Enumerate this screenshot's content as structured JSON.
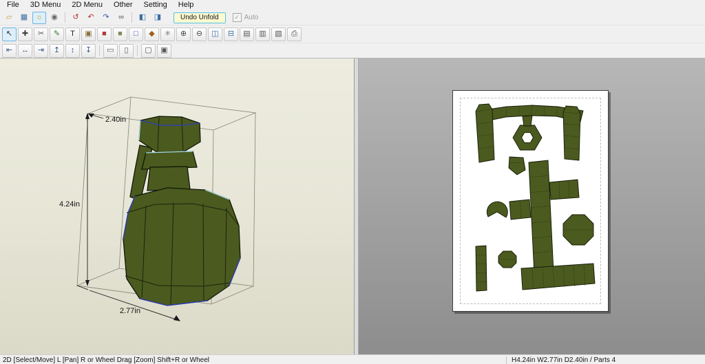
{
  "menubar": {
    "items": [
      {
        "label": "File"
      },
      {
        "label": "3D Menu"
      },
      {
        "label": "2D Menu"
      },
      {
        "label": "Other"
      },
      {
        "label": "Setting"
      },
      {
        "label": "Help"
      }
    ]
  },
  "toolbar_main": {
    "icons": [
      {
        "name": "open-file-icon",
        "glyph": "▱",
        "color": "#c89638"
      },
      {
        "name": "save-file-icon",
        "glyph": "▦",
        "color": "#3a6ea5"
      },
      {
        "name": "light-toggle-icon",
        "glyph": "☼",
        "color": "#d89c00",
        "active": true
      },
      {
        "name": "snapshot-icon",
        "glyph": "◉",
        "color": "#666666"
      },
      {
        "type": "sep"
      },
      {
        "name": "reset-view-icon",
        "glyph": "↺",
        "color": "#b83030"
      },
      {
        "name": "rotate-ccw-icon",
        "glyph": "↶",
        "color": "#b83030"
      },
      {
        "name": "rotate-cw-icon",
        "glyph": "↷",
        "color": "#3353b8"
      },
      {
        "name": "joint-edit-icon",
        "glyph": "∞",
        "color": "#555555"
      },
      {
        "type": "sep"
      },
      {
        "name": "layout-3d-pane-icon",
        "glyph": "◧",
        "color": "#3a6ea5"
      },
      {
        "name": "layout-2d-pane-icon",
        "glyph": "◨",
        "color": "#3a6ea5"
      }
    ],
    "undo_unfold_label": "Undo Unfold",
    "auto_label": "Auto",
    "auto_checked": true,
    "check_glyph": "✓"
  },
  "toolbar_tools": {
    "icons": [
      {
        "name": "select-move-icon",
        "glyph": "↖",
        "color": "#222222",
        "active": true
      },
      {
        "name": "move-page-icon",
        "glyph": "✚",
        "color": "#444444"
      },
      {
        "name": "divide-edge-icon",
        "glyph": "✂",
        "color": "#555555"
      },
      {
        "name": "edge-color-icon",
        "glyph": "✎",
        "color": "#2e7d32"
      },
      {
        "name": "text-tool-icon",
        "glyph": "T",
        "color": "#222222"
      },
      {
        "name": "image-tool-icon",
        "glyph": "▣",
        "color": "#8a6d3b"
      },
      {
        "name": "solid-view-icon",
        "glyph": "■",
        "color": "#b03a3a"
      },
      {
        "name": "texture-view-icon",
        "glyph": "■",
        "color": "#8a8a5a"
      },
      {
        "name": "wireframe-view-icon",
        "glyph": "□",
        "color": "#3353b8"
      },
      {
        "name": "material-icon",
        "glyph": "◆",
        "color": "#a06020"
      },
      {
        "name": "repair-icon",
        "glyph": "✳",
        "color": "#777777"
      },
      {
        "name": "check-2d3d-icon",
        "glyph": "⊕",
        "color": "#444444"
      },
      {
        "name": "measure-icon",
        "glyph": "⊖",
        "color": "#444444"
      },
      {
        "name": "split-window-icon",
        "glyph": "◫",
        "color": "#3a6ea5"
      },
      {
        "name": "merge-window-icon",
        "glyph": "⊟",
        "color": "#3a6ea5"
      },
      {
        "name": "sheet-list-icon",
        "glyph": "▤",
        "color": "#555555"
      },
      {
        "name": "texture-window-icon",
        "glyph": "▥",
        "color": "#555555"
      },
      {
        "name": "export-icon",
        "glyph": "▧",
        "color": "#555555"
      },
      {
        "name": "print-icon",
        "glyph": "⎙",
        "color": "#444444"
      }
    ]
  },
  "toolbar_align": {
    "icons": [
      {
        "name": "align-left-icon",
        "glyph": "⇤",
        "color": "#3a5a8a"
      },
      {
        "name": "align-center-h-icon",
        "glyph": "↔",
        "color": "#3a5a8a"
      },
      {
        "name": "align-right-icon",
        "glyph": "⇥",
        "color": "#3a5a8a"
      },
      {
        "name": "align-top-icon",
        "glyph": "↥",
        "color": "#3a5a8a"
      },
      {
        "name": "align-middle-icon",
        "glyph": "↕",
        "color": "#3a5a8a"
      },
      {
        "name": "align-bottom-icon",
        "glyph": "↧",
        "color": "#3a5a8a"
      },
      {
        "type": "sep"
      },
      {
        "name": "arrange-parts-icon",
        "glyph": "▭",
        "color": "#555555"
      },
      {
        "name": "page-setup-icon",
        "glyph": "▯",
        "color": "#555555"
      },
      {
        "type": "sep"
      },
      {
        "name": "select-rect-icon",
        "glyph": "▢",
        "color": "#555555"
      },
      {
        "name": "select-parts-icon",
        "glyph": "▣",
        "color": "#555555"
      }
    ]
  },
  "viewport3d": {
    "dim_top": "2.40in",
    "dim_height": "4.24in",
    "dim_bottom": "2.77in"
  },
  "statusbar": {
    "left": "2D [Select/Move] L [Pan] R or Wheel Drag [Zoom] Shift+R or Wheel",
    "right": "H4.24in W2.77in D2.40in / Parts 4"
  },
  "colors": {
    "model": "#4b5a1e",
    "page_bg": "#ffffff",
    "pane3d_bg": "#e9e8da",
    "pane2d_bg": "#a5a5a5",
    "accent_active": "#6fb2e0",
    "undo_button_border": "#4fc2e4",
    "undo_button_bg": "#fcf9d2"
  }
}
